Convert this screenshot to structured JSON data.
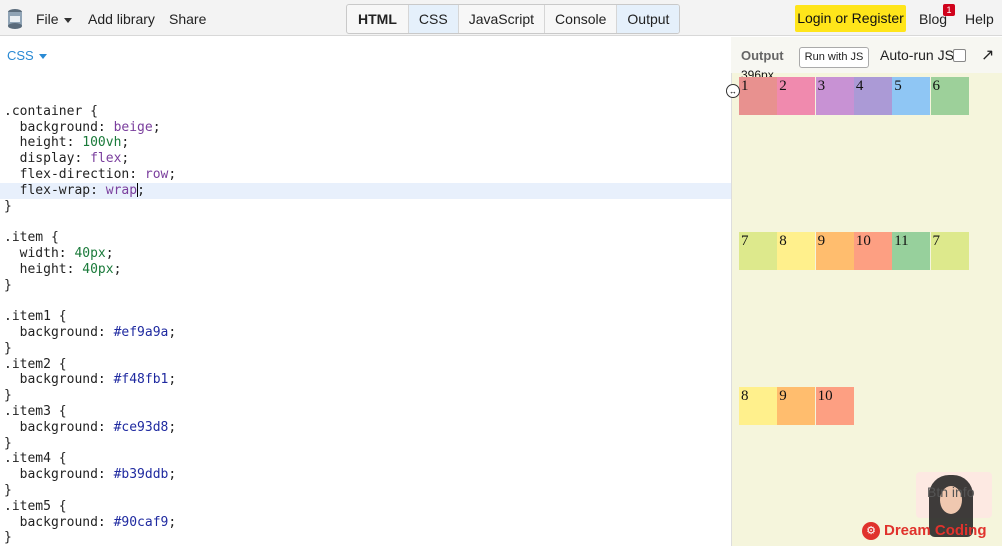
{
  "menu": {
    "file": "File",
    "add_library": "Add library",
    "share": "Share"
  },
  "tabs": [
    "HTML",
    "CSS",
    "JavaScript",
    "Console",
    "Output"
  ],
  "login_label": "Login or Register",
  "blog_label": "Blog",
  "blog_badge": "1",
  "help_label": "Help",
  "editor": {
    "language": "CSS",
    "lines": [
      "",
      ".container {",
      "  background: beige;",
      "  height: 100vh;",
      "  display: flex;",
      "  flex-direction: row;",
      "  flex-wrap: wrap;",
      "}",
      "",
      ".item {",
      "  width: 40px;",
      "  height: 40px;",
      "}",
      "",
      ".item1 {",
      "  background: #ef9a9a;",
      "}",
      ".item2 {",
      "  background: #f48fb1;",
      "}",
      ".item3 {",
      "  background: #ce93d8;",
      "}",
      ".item4 {",
      "  background: #b39ddb;",
      "}",
      ".item5 {",
      "  background: #90caf9;",
      "}"
    ]
  },
  "output": {
    "title": "Output",
    "run_label": "Run with JS",
    "autorun_label": "Auto-run JS",
    "width_label": "396px",
    "rows": [
      [
        {
          "label": "1",
          "color": "#e8918f"
        },
        {
          "label": "2",
          "color": "#f08aae"
        },
        {
          "label": "3",
          "color": "#c892d4"
        },
        {
          "label": "4",
          "color": "#ab9ad6"
        },
        {
          "label": "5",
          "color": "#8fc6f4"
        },
        {
          "label": "6",
          "color": "#9dd09a"
        }
      ],
      [
        {
          "label": "7",
          "color": "#dde98c"
        },
        {
          "label": "8",
          "color": "#fff08c"
        },
        {
          "label": "9",
          "color": "#ffbd6e"
        },
        {
          "label": "10",
          "color": "#fd9f82"
        },
        {
          "label": "11",
          "color": "#97d09c"
        },
        {
          "label": "7",
          "color": "#dde98c"
        }
      ],
      [
        {
          "label": "8",
          "color": "#fff08c"
        },
        {
          "label": "9",
          "color": "#ffbd6e"
        },
        {
          "label": "10",
          "color": "#fd9f82"
        }
      ]
    ]
  },
  "watermark": {
    "overlay_text": "Btn info",
    "brand": "Dream Coding"
  }
}
